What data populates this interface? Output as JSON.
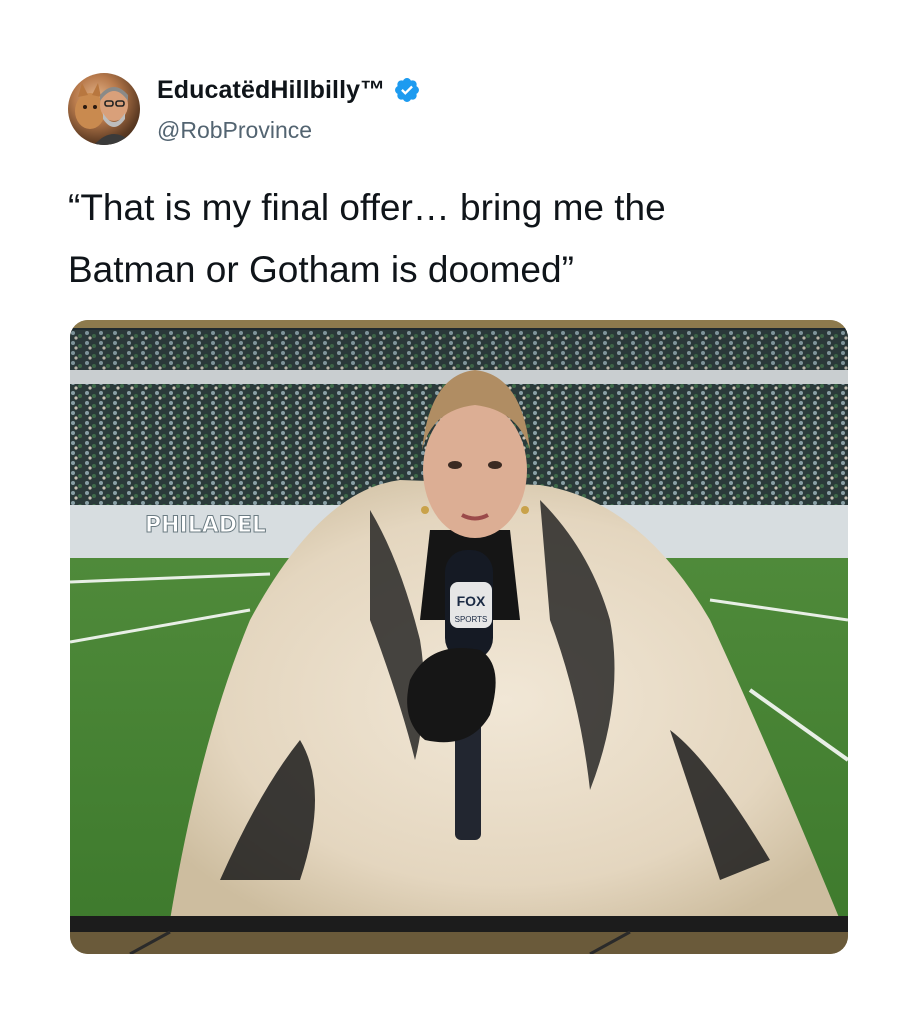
{
  "tweet": {
    "display_name": "EducatëdHillbilly™",
    "handle": "@RobProvince",
    "verified_icon": "verified-badge-icon",
    "text_line1": "“That is my final offer… bring me the",
    "text_line2": "Batman or Gotham is doomed”"
  },
  "media": {
    "description_icon": "broadcast-photo",
    "stadium_sign": "PHILADEL",
    "mic_flag_line1": "FOX",
    "mic_flag_line2": "SPORTS"
  },
  "colors": {
    "verified_blue": "#1d9bf0",
    "text": "#0f1419",
    "secondary": "#536471"
  }
}
